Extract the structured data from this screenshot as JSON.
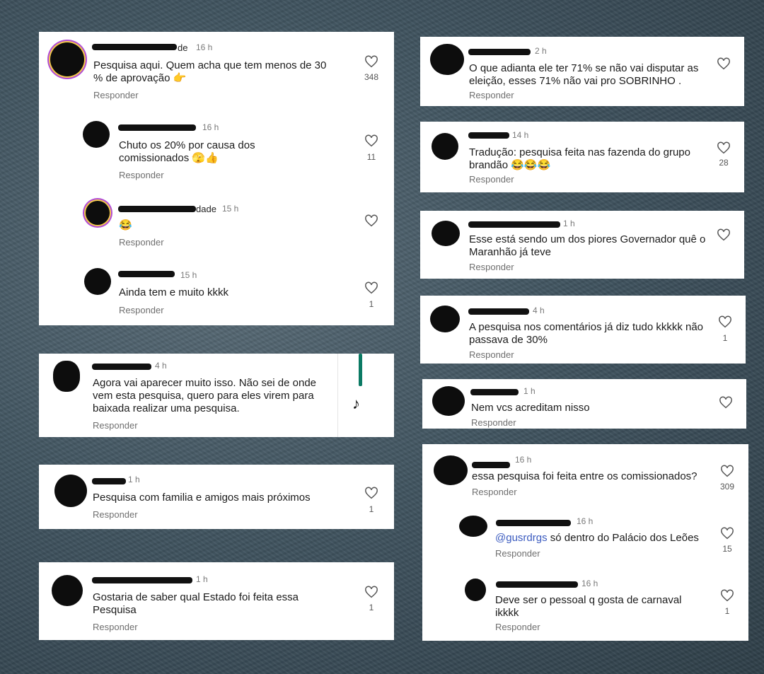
{
  "left": {
    "card1": {
      "comments": [
        {
          "time": "16 h",
          "name_tail": "de",
          "text": "Pesquisa aqui. Quem acha que tem menos de 30 % de aprovação 👉",
          "reply": "Responder",
          "likes": "348"
        },
        {
          "time": "16 h",
          "name_tail": "",
          "text": "Chuto os 20% por causa dos comissionados 🫣👍",
          "reply": "Responder",
          "likes": "11"
        },
        {
          "time": "15 h",
          "name_tail": "dade",
          "text": "😂",
          "reply": "Responder",
          "likes": ""
        },
        {
          "time": "15 h",
          "name_tail": "",
          "text": "Ainda tem e muito kkkk",
          "reply": "Responder",
          "likes": "1"
        }
      ]
    },
    "card2": {
      "time": "4 h",
      "text": "Agora vai aparecer muito isso. Não sei de onde vem esta pesquisa, quero para eles virem para baixada realizar uma pesquisa.",
      "reply": "Responder",
      "likes": ""
    },
    "card3": {
      "time": "1 h",
      "text": "Pesquisa com familia e amigos mais próximos",
      "reply": "Responder",
      "likes": "1"
    },
    "card4": {
      "time": "1 h",
      "text": "Gostaria de saber qual Estado foi feita essa Pesquisa",
      "reply": "Responder",
      "likes": "1"
    }
  },
  "right": {
    "card1": {
      "time": "2 h",
      "text": "O que adianta ele ter 71% se não vai disputar as eleição, esses 71% não vai pro SOBRINHO .",
      "reply": "Responder",
      "likes": ""
    },
    "card2": {
      "time": "14 h",
      "text": "Tradução: pesquisa feita nas fazenda do grupo brandão 😂😂😂",
      "reply": "Responder",
      "likes": "28"
    },
    "card3": {
      "time": "1 h",
      "text": "Esse está sendo um dos piores Governador quê o Maranhão já teve",
      "reply": "Responder",
      "likes": ""
    },
    "card4": {
      "time": "4 h",
      "text": "A pesquisa nos comentários já diz tudo kkkkk não passava de 30%",
      "reply": "Responder",
      "likes": "1"
    },
    "card5": {
      "time": "1 h",
      "text": "Nem vcs acreditam nisso",
      "reply": "Responder",
      "likes": ""
    },
    "card6": {
      "comments": [
        {
          "time": "16 h",
          "text": "essa pesquisa foi feita entre os comissionados?",
          "reply": "Responder",
          "likes": "309"
        },
        {
          "time": "16 h",
          "mention": "@gusrdrgs",
          "text": " só dentro do Palácio dos Leões",
          "reply": "Responder",
          "likes": "15"
        },
        {
          "time": "16 h",
          "text": "Deve ser o pessoal q gosta de carnaval ikkkk",
          "reply": "Responder",
          "likes": "1"
        }
      ]
    }
  },
  "icons": {
    "like": "heart-outline-icon",
    "tiktok": "tiktok-logo-icon"
  }
}
